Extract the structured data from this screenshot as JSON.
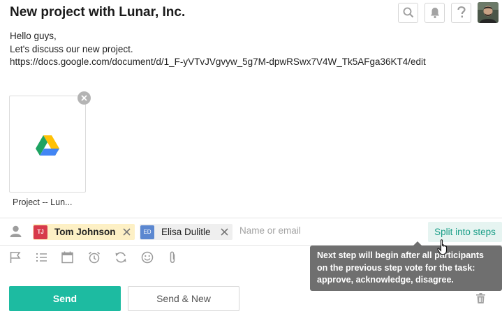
{
  "header": {
    "title": "New project with Lunar, Inc."
  },
  "top_icons": [
    "search-icon",
    "bell-icon",
    "help-icon",
    "user-avatar"
  ],
  "message": {
    "greeting": "Hello guys,",
    "body": "Let's discuss our new project.",
    "link": "https://docs.google.com/document/d/1_F-yVTvJVgvyw_5g7M-dpwRSwx7V4W_Tk5AFga36KT4/edit"
  },
  "attachment": {
    "name": "Project -- Lun...",
    "icon": "google-drive-icon"
  },
  "participants": {
    "chips": [
      {
        "initials": "TJ",
        "name": "Tom Johnson",
        "color": "#d73a4a"
      },
      {
        "initials": "ED",
        "name": "Elisa Dulitle",
        "color": "#5b87d0"
      }
    ],
    "placeholder": "Name or email",
    "split_label": "Split into steps"
  },
  "tooltip": {
    "text": "Next step will begin after all participants on the previous step vote for the task: approve, acknowledge, disagree."
  },
  "toolbar_icons": [
    "flag-icon",
    "checklist-icon",
    "calendar-icon",
    "alarm-icon",
    "repeat-icon",
    "emoji-icon",
    "attach-icon"
  ],
  "actions": {
    "send": "Send",
    "send_new": "Send & New"
  },
  "colors": {
    "accent": "#1dbba1",
    "split_bg": "#e6f4f1",
    "tooltip_bg": "#6f6f6f",
    "tj_badge": "#d73a4a",
    "ed_badge": "#5b87d0",
    "tj_chip_bg": "#fdf0c5"
  }
}
